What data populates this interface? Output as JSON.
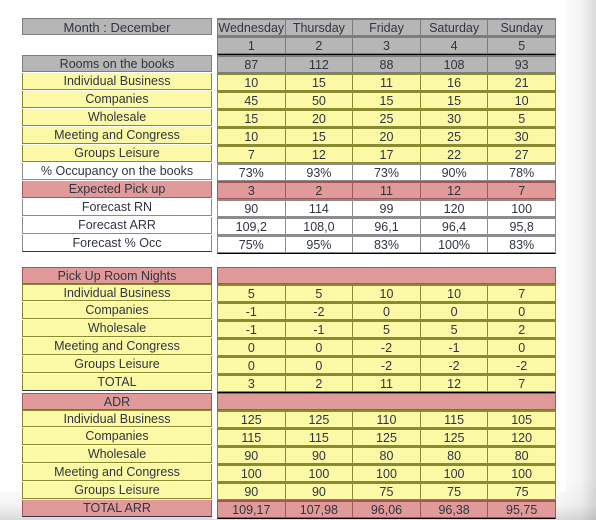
{
  "sheet": {
    "title": "Month : December",
    "day_names": [
      "Wednesday",
      "Thursday",
      "Friday",
      "Saturday",
      "Sunday"
    ],
    "day_numbers": [
      "1",
      "2",
      "3",
      "4",
      "5"
    ]
  },
  "colors": {
    "header_gray": "#b6b6b6",
    "row_yellow": "#fbf9a5",
    "row_white": "#ffffff",
    "row_pink": "#e09a9a",
    "text": "#2f3542"
  },
  "section_books": {
    "rows": [
      {
        "label": "Rooms on the books",
        "style": "gray",
        "values": [
          "87",
          "112",
          "88",
          "108",
          "93"
        ]
      },
      {
        "label": "Individual Business",
        "style": "yellow",
        "values": [
          "10",
          "15",
          "11",
          "16",
          "21"
        ]
      },
      {
        "label": "Companies",
        "style": "yellow",
        "values": [
          "45",
          "50",
          "15",
          "15",
          "10"
        ]
      },
      {
        "label": "Wholesale",
        "style": "yellow",
        "values": [
          "15",
          "20",
          "25",
          "30",
          "5"
        ]
      },
      {
        "label": "Meeting and Congress",
        "style": "yellow",
        "values": [
          "10",
          "15",
          "20",
          "25",
          "30"
        ]
      },
      {
        "label": "Groups Leisure",
        "style": "yellow",
        "values": [
          "7",
          "12",
          "17",
          "22",
          "27"
        ]
      },
      {
        "label": "% Occupancy on the books",
        "style": "white",
        "values": [
          "73%",
          "93%",
          "73%",
          "90%",
          "78%"
        ]
      },
      {
        "label": "Expected Pick up",
        "style": "pink",
        "values": [
          "3",
          "2",
          "11",
          "12",
          "7"
        ]
      },
      {
        "label": "Forecast RN",
        "style": "white",
        "values": [
          "90",
          "114",
          "99",
          "120",
          "100"
        ]
      },
      {
        "label": "Forecast ARR",
        "style": "white",
        "values": [
          "109,2",
          "108,0",
          "96,1",
          "96,4",
          "95,8"
        ]
      },
      {
        "label": "Forecast % Occ",
        "style": "white",
        "values": [
          "75%",
          "95%",
          "83%",
          "100%",
          "83%"
        ]
      }
    ]
  },
  "section_pickup": {
    "header": "Pick Up Room Nights",
    "rows": [
      {
        "label": "Individual Business",
        "style": "yellow",
        "values": [
          "5",
          "5",
          "10",
          "10",
          "7"
        ]
      },
      {
        "label": "Companies",
        "style": "yellow",
        "values": [
          "-1",
          "-2",
          "0",
          "0",
          "0"
        ]
      },
      {
        "label": "Wholesale",
        "style": "yellow",
        "values": [
          "-1",
          "-1",
          "5",
          "5",
          "2"
        ]
      },
      {
        "label": "Meeting and Congress",
        "style": "yellow",
        "values": [
          "0",
          "0",
          "-2",
          "-1",
          "0"
        ]
      },
      {
        "label": "Groups Leisure",
        "style": "yellow",
        "values": [
          "0",
          "0",
          "-2",
          "-2",
          "-2"
        ]
      },
      {
        "label": "TOTAL",
        "style": "yellow",
        "values": [
          "3",
          "2",
          "11",
          "12",
          "7"
        ]
      }
    ]
  },
  "section_adr": {
    "header": "ADR",
    "rows": [
      {
        "label": "Individual Business",
        "style": "yellow",
        "values": [
          "125",
          "125",
          "110",
          "115",
          "105"
        ]
      },
      {
        "label": "Companies",
        "style": "yellow",
        "values": [
          "115",
          "115",
          "125",
          "125",
          "120"
        ]
      },
      {
        "label": "Wholesale",
        "style": "yellow",
        "values": [
          "90",
          "90",
          "80",
          "80",
          "80"
        ]
      },
      {
        "label": "Meeting and Congress",
        "style": "yellow",
        "values": [
          "100",
          "100",
          "100",
          "100",
          "100"
        ]
      },
      {
        "label": "Groups Leisure",
        "style": "yellow",
        "values": [
          "90",
          "90",
          "75",
          "75",
          "75"
        ]
      },
      {
        "label": "TOTAL ARR",
        "style": "pink",
        "values": [
          "109,17",
          "107,98",
          "96,06",
          "96,38",
          "95,75"
        ]
      }
    ]
  }
}
